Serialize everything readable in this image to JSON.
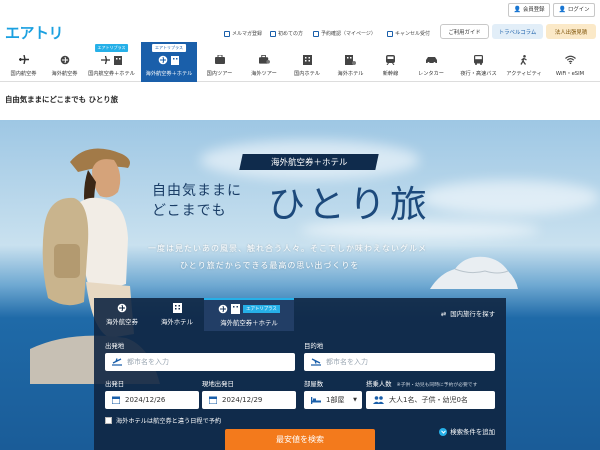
{
  "brand": {
    "logo_text": "エアトリ"
  },
  "header": {
    "member_register": "会員登録",
    "login": "ログイン",
    "links": [
      "メルマガ登録",
      "初めての方",
      "予約確認（マイページ）",
      "キャンセル受付"
    ],
    "guide": "ご利用ガイド",
    "column": "トラベルコラム",
    "corporate": "法人出張見積"
  },
  "nav": {
    "badge_text": "エアトリプラス",
    "items": [
      {
        "label": "国内航空券",
        "icon": "plane-icon"
      },
      {
        "label": "海外航空券",
        "icon": "globe-plane-icon"
      },
      {
        "label": "国内航空券＋ホテル",
        "icon": "plane-hotel-icon",
        "badge": true
      },
      {
        "label": "海外航空券＋ホテル",
        "icon": "globe-hotel-icon",
        "badge": true,
        "active": true
      },
      {
        "label": "国内ツアー",
        "icon": "suitcase-icon"
      },
      {
        "label": "海外ツアー",
        "icon": "suitcase-globe-icon"
      },
      {
        "label": "国内ホテル",
        "icon": "building-icon"
      },
      {
        "label": "海外ホテル",
        "icon": "building-globe-icon"
      },
      {
        "label": "新幹線",
        "icon": "train-icon"
      },
      {
        "label": "レンタカー",
        "icon": "car-icon"
      },
      {
        "label": "夜行・高速バス",
        "icon": "bus-icon"
      },
      {
        "label": "アクティビティ",
        "icon": "walker-icon"
      },
      {
        "label": "WiFi・eSIM",
        "icon": "wifi-icon"
      }
    ]
  },
  "breadcrumb": "自由気ままにどこまでも ひとり旅",
  "hero": {
    "badge": "海外航空券＋ホテル",
    "title_line1": "自由気ままに",
    "title_line2": "どこまでも",
    "title_big": "ひとり旅",
    "sub1": "一度は見たいあの風景、触れ合う人々。そこでしか味わえないグルメ",
    "sub2": "ひとり旅だからできる最高の思い出づくりを"
  },
  "search": {
    "tabs": [
      {
        "label": "海外航空券",
        "icon": "globe-plane-icon"
      },
      {
        "label": "海外ホテル",
        "icon": "building-icon"
      },
      {
        "label": "海外航空券＋ホテル",
        "icon": "globe-hotel-icon",
        "badge": "エアトリプラス",
        "active": true
      }
    ],
    "domestic_link": "国内旅行を探す",
    "departure_label": "出発地",
    "departure_placeholder": "都市名を入力",
    "destination_label": "目的地",
    "destination_placeholder": "都市名を入力",
    "depart_date_label": "出発日",
    "depart_date": "2024/12/26",
    "return_date_label": "現地出発日",
    "return_date": "2024/12/29",
    "rooms_label": "部屋数",
    "rooms_value": "1部屋",
    "guests_label": "搭乗人数",
    "guests_note": "※子供・幼児も同時に予約が必要です",
    "guests_value": "大人1名、子供・幼児0名",
    "checkbox_label": "海外ホテルは航空券と違う日程で予約",
    "more_conditions": "検索条件を追加",
    "submit": "最安値を検索"
  },
  "colors": {
    "brand_blue": "#1a5faa",
    "accent_cyan": "#26b0e8",
    "search_orange": "#f37a1c",
    "panel_navy": "#102642"
  }
}
